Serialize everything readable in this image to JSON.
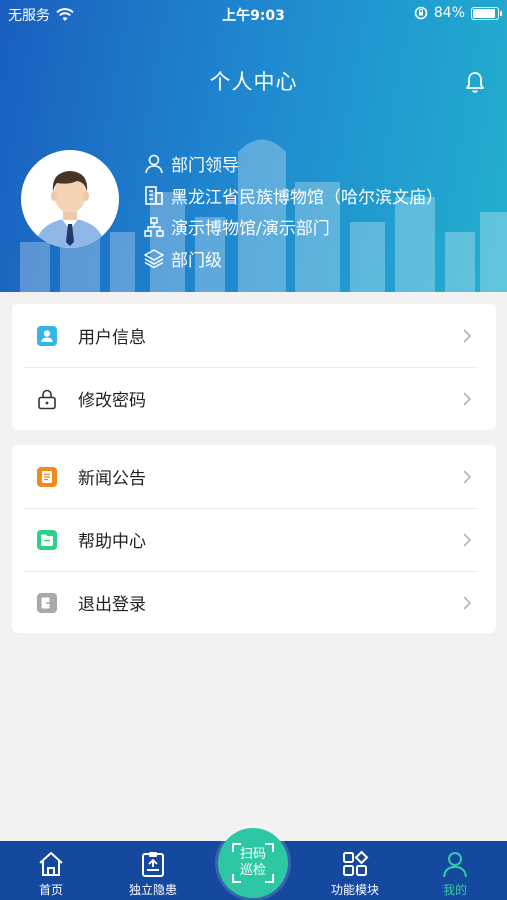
{
  "status_bar": {
    "carrier": "无服务",
    "time": "上午9:03",
    "battery_percent": "84%",
    "battery_level": 0.84
  },
  "header": {
    "title": "个人中心",
    "role": "部门领导",
    "organization": "黑龙江省民族博物馆（哈尔滨文庙）",
    "department": "演示博物馆/演示部门",
    "level": "部门级"
  },
  "menu_group_1": [
    {
      "label": "用户信息",
      "icon": "user-info-icon",
      "color": "#35b5e5"
    },
    {
      "label": "修改密码",
      "icon": "lock-icon",
      "color": "#333333"
    }
  ],
  "menu_group_2": [
    {
      "label": "新闻公告",
      "icon": "news-icon",
      "color": "#f08a1c"
    },
    {
      "label": "帮助中心",
      "icon": "help-icon",
      "color": "#2fcf8a"
    },
    {
      "label": "退出登录",
      "icon": "logout-icon",
      "color": "#a9a9a9"
    }
  ],
  "tabbar": {
    "home": "首页",
    "hazard": "独立隐患",
    "scan": "扫码巡检",
    "modules": "功能模块",
    "mine": "我的"
  },
  "colors": {
    "accent": "#2ec7a4",
    "tabbar_bg": "#1549a0",
    "header_start": "#1a5fbf",
    "header_end": "#22b0cf"
  }
}
